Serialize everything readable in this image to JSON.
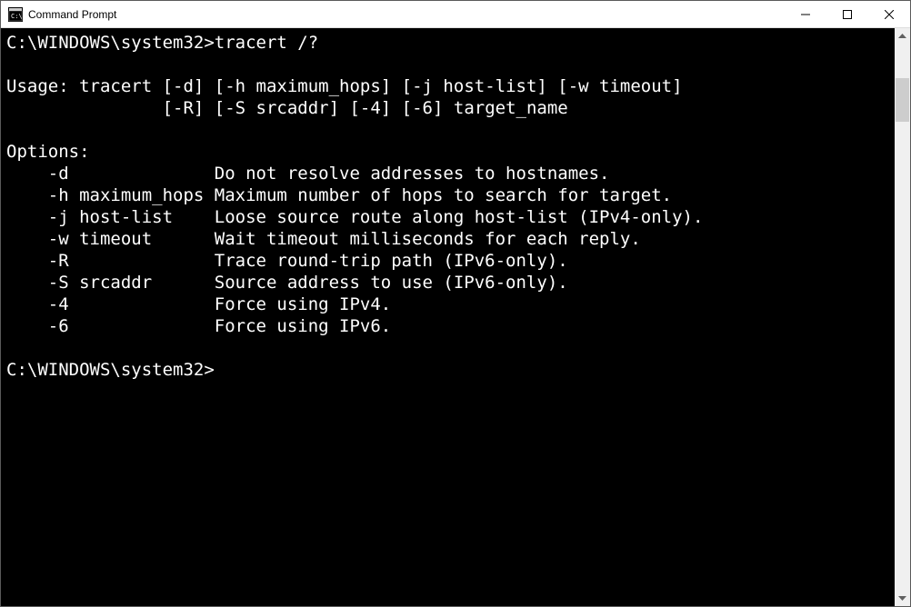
{
  "window": {
    "title": "Command Prompt"
  },
  "terminal": {
    "prompt": "C:\\WINDOWS\\system32>",
    "command": "tracert /?",
    "blank": "",
    "usage_line1": "Usage: tracert [-d] [-h maximum_hops] [-j host-list] [-w timeout]",
    "usage_line2": "               [-R] [-S srcaddr] [-4] [-6] target_name",
    "options_header": "Options:",
    "options": [
      {
        "flag": "    -d",
        "desc": "Do not resolve addresses to hostnames."
      },
      {
        "flag": "    -h maximum_hops",
        "desc": "Maximum number of hops to search for target."
      },
      {
        "flag": "    -j host-list",
        "desc": "Loose source route along host-list (IPv4-only)."
      },
      {
        "flag": "    -w timeout",
        "desc": "Wait timeout milliseconds for each reply."
      },
      {
        "flag": "    -R",
        "desc": "Trace round-trip path (IPv6-only)."
      },
      {
        "flag": "    -S srcaddr",
        "desc": "Source address to use (IPv6-only)."
      },
      {
        "flag": "    -4",
        "desc": "Force using IPv4."
      },
      {
        "flag": "    -6",
        "desc": "Force using IPv6."
      }
    ],
    "prompt2": "C:\\WINDOWS\\system32>"
  }
}
